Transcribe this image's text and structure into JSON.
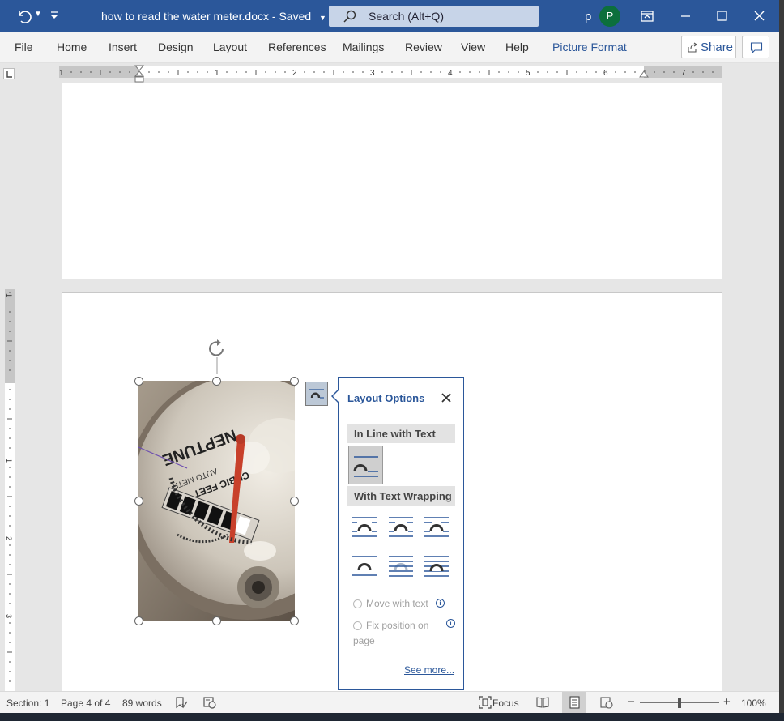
{
  "titlebar": {
    "doc_name": "how to read the water meter.docx",
    "save_status": "Saved",
    "search_placeholder": "Search (Alt+Q)",
    "user_letter": "p",
    "avatar_initial": "P"
  },
  "ribbon": {
    "tabs": [
      "File",
      "Home",
      "Insert",
      "Design",
      "Layout",
      "References",
      "Mailings",
      "Review",
      "View",
      "Help",
      "Picture Format"
    ],
    "active_tab": "Picture Format",
    "share_label": "Share"
  },
  "ruler": {
    "h_numbers": [
      "1",
      "1",
      "2",
      "3",
      "4",
      "5",
      "6",
      "7"
    ],
    "v_numbers": [
      "1",
      "1",
      "2",
      "3"
    ]
  },
  "layout_options": {
    "title": "Layout Options",
    "inline_heading": "In Line with Text",
    "wrapping_heading": "With Text Wrapping",
    "move_with_text": "Move with text",
    "fix_position": "Fix position on page",
    "see_more": "See more..."
  },
  "statusbar": {
    "section": "Section: 1",
    "page": "Page 4 of 4",
    "words": "89 words",
    "focus": "Focus",
    "zoom": "100%",
    "zoom_level_percent": 100
  },
  "colors": {
    "title_bar": "#2b579a",
    "accent": "#2b579a",
    "avatar": "#0c6f3c",
    "ribbon": "#f3f3f3"
  },
  "icons": [
    "undo-icon",
    "customize-qat-icon",
    "search-icon",
    "ribbon-display-icon",
    "minimize-icon",
    "maximize-icon",
    "close-icon",
    "share-icon",
    "comment-icon",
    "rotate-handle-icon",
    "layout-options-icon",
    "info-icon",
    "read-mode-icon",
    "print-layout-icon",
    "web-layout-icon",
    "focus-icon",
    "proofing-icon",
    "accessibility-icon"
  ]
}
